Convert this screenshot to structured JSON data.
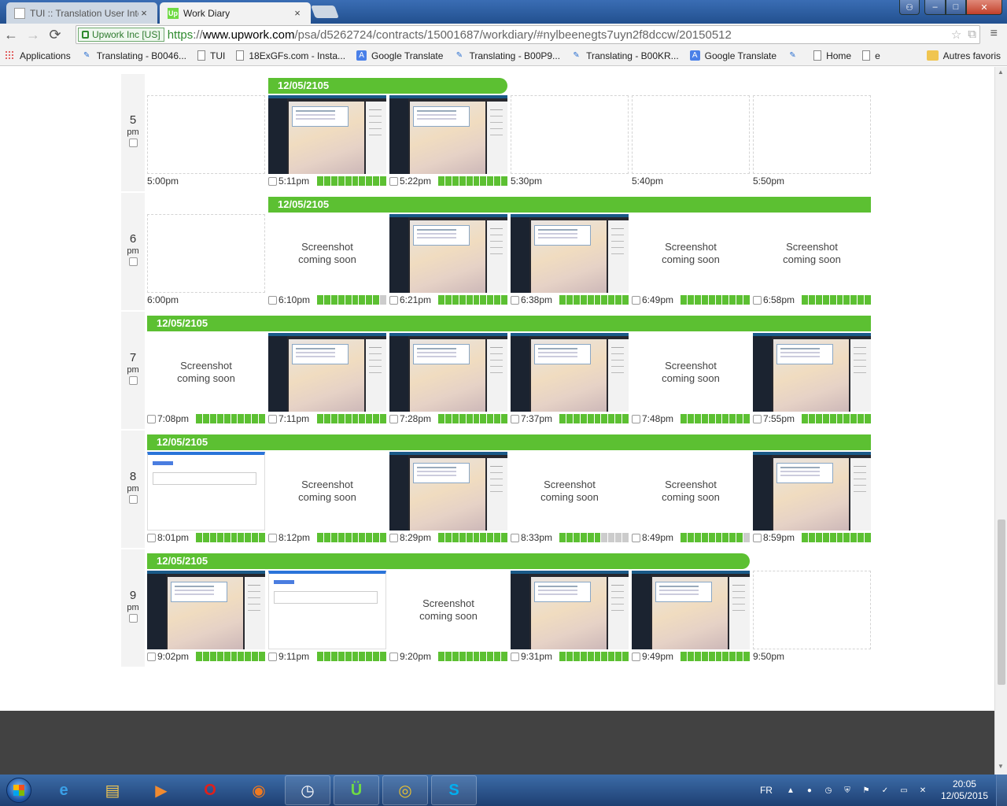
{
  "browser": {
    "tabs": [
      {
        "label": "TUI :: Translation User Inte",
        "active": false
      },
      {
        "label": "Work Diary",
        "active": true
      }
    ],
    "tab_close": "×",
    "back_icon": "←",
    "forward_icon": "→",
    "reload_icon": "⟳",
    "security_label": "Upwork Inc [US]",
    "url_scheme": "https",
    "url_sep": "://",
    "url_host": "www.upwork.com",
    "url_path": "/psa/d5262724/contracts/15001687/workdiary/#nylbeenegts7uyn2f8dccw/20150512",
    "star_icon": "☆",
    "menu_icon": "≡",
    "window_buttons": {
      "minimize": "–",
      "maximize": "□",
      "close": "✕"
    }
  },
  "bookmarks": [
    {
      "label": "Applications",
      "icon": "apps-grid-icon"
    },
    {
      "label": "Translating - B0046...",
      "icon": "translating-icon"
    },
    {
      "label": "TUI",
      "icon": "page-icon"
    },
    {
      "label": "18ExGFs.com - Insta...",
      "icon": "page-icon"
    },
    {
      "label": "Google Translate",
      "icon": "google-translate-icon"
    },
    {
      "label": "Translating - B00P9...",
      "icon": "translating-icon"
    },
    {
      "label": "Translating - B00KR...",
      "icon": "translating-icon"
    },
    {
      "label": "Google Translate",
      "icon": "google-translate-icon"
    },
    {
      "label": "",
      "icon": "translating-icon"
    },
    {
      "label": "Home",
      "icon": "page-icon"
    },
    {
      "label": "e",
      "icon": "page-icon"
    }
  ],
  "other_bookmarks": "Autres favoris",
  "colors": {
    "accent_green": "#5cc032",
    "meter_off": "#cccccc",
    "footer": "#424242"
  },
  "diary": {
    "screenshot_soon_line1": "Screenshot",
    "screenshot_soon_line2": "coming soon",
    "hours": [
      {
        "hour": "5",
        "ampm": "pm",
        "date": "12/05/2105",
        "bar_start": 1,
        "bar_end": 3,
        "slots": [
          {
            "time": "5:00pm",
            "kind": "empty",
            "checkbox": false,
            "activity": 0
          },
          {
            "time": "5:11pm",
            "kind": "screenshot",
            "checkbox": true,
            "activity": 10
          },
          {
            "time": "5:22pm",
            "kind": "screenshot",
            "checkbox": true,
            "activity": 10
          },
          {
            "time": "5:30pm",
            "kind": "empty",
            "checkbox": false,
            "activity": 0
          },
          {
            "time": "5:40pm",
            "kind": "empty",
            "checkbox": false,
            "activity": 0
          },
          {
            "time": "5:50pm",
            "kind": "empty",
            "checkbox": false,
            "activity": 0
          }
        ]
      },
      {
        "hour": "6",
        "ampm": "pm",
        "date": "12/05/2105",
        "bar_start": 1,
        "bar_end": 6,
        "slots": [
          {
            "time": "6:00pm",
            "kind": "empty",
            "checkbox": false,
            "activity": 0
          },
          {
            "time": "6:10pm",
            "kind": "soon",
            "checkbox": true,
            "activity": 9
          },
          {
            "time": "6:21pm",
            "kind": "screenshot",
            "checkbox": true,
            "activity": 10
          },
          {
            "time": "6:38pm",
            "kind": "screenshot",
            "checkbox": true,
            "activity": 10
          },
          {
            "time": "6:49pm",
            "kind": "soon",
            "checkbox": true,
            "activity": 10
          },
          {
            "time": "6:58pm",
            "kind": "soon",
            "checkbox": true,
            "activity": 10
          }
        ]
      },
      {
        "hour": "7",
        "ampm": "pm",
        "date": "12/05/2105",
        "bar_start": 0,
        "bar_end": 6,
        "slots": [
          {
            "time": "7:08pm",
            "kind": "soon",
            "checkbox": true,
            "activity": 10
          },
          {
            "time": "7:11pm",
            "kind": "screenshot",
            "checkbox": true,
            "activity": 10
          },
          {
            "time": "7:28pm",
            "kind": "screenshot",
            "checkbox": true,
            "activity": 10
          },
          {
            "time": "7:37pm",
            "kind": "screenshot",
            "checkbox": true,
            "activity": 10
          },
          {
            "time": "7:48pm",
            "kind": "soon",
            "checkbox": true,
            "activity": 10
          },
          {
            "time": "7:55pm",
            "kind": "screenshot",
            "checkbox": true,
            "activity": 10
          }
        ]
      },
      {
        "hour": "8",
        "ampm": "pm",
        "date": "12/05/2105",
        "bar_start": 0,
        "bar_end": 6,
        "slots": [
          {
            "time": "8:01pm",
            "kind": "google",
            "checkbox": true,
            "activity": 10
          },
          {
            "time": "8:12pm",
            "kind": "soon",
            "checkbox": true,
            "activity": 10
          },
          {
            "time": "8:29pm",
            "kind": "screenshot",
            "checkbox": true,
            "activity": 10
          },
          {
            "time": "8:33pm",
            "kind": "soon",
            "checkbox": true,
            "activity": 6
          },
          {
            "time": "8:49pm",
            "kind": "soon",
            "checkbox": true,
            "activity": 9
          },
          {
            "time": "8:59pm",
            "kind": "screenshot",
            "checkbox": true,
            "activity": 10
          }
        ]
      },
      {
        "hour": "9",
        "ampm": "pm",
        "date": "12/05/2105",
        "bar_start": 0,
        "bar_end": 5,
        "slots": [
          {
            "time": "9:02pm",
            "kind": "screenshot",
            "checkbox": true,
            "activity": 10
          },
          {
            "time": "9:11pm",
            "kind": "google",
            "checkbox": true,
            "activity": 10
          },
          {
            "time": "9:20pm",
            "kind": "soon",
            "checkbox": true,
            "activity": 10
          },
          {
            "time": "9:31pm",
            "kind": "screenshot",
            "checkbox": true,
            "activity": 10
          },
          {
            "time": "9:49pm",
            "kind": "screenshot",
            "checkbox": true,
            "activity": 10
          },
          {
            "time": "9:50pm",
            "kind": "empty",
            "checkbox": false,
            "activity": 0
          }
        ]
      }
    ]
  },
  "taskbar": {
    "apps": [
      {
        "name": "internet-explorer-icon",
        "glyph": "e",
        "color": "#3aa0e8"
      },
      {
        "name": "file-explorer-icon",
        "glyph": "▤",
        "color": "#f0c550"
      },
      {
        "name": "media-player-icon",
        "glyph": "▶",
        "color": "#f08a30"
      },
      {
        "name": "opera-icon",
        "glyph": "O",
        "color": "#e0201a"
      },
      {
        "name": "firefox-icon",
        "glyph": "◉",
        "color": "#f07a20"
      },
      {
        "name": "clock-app-icon",
        "glyph": "◷",
        "color": "#ffffff"
      },
      {
        "name": "upwork-app-icon",
        "glyph": "Ü",
        "color": "#6fda44"
      },
      {
        "name": "chrome-icon",
        "glyph": "◎",
        "color": "#e8c030"
      },
      {
        "name": "skype-icon",
        "glyph": "S",
        "color": "#00aff0"
      }
    ],
    "language": "FR",
    "time": "20:05",
    "date": "12/05/2015"
  }
}
